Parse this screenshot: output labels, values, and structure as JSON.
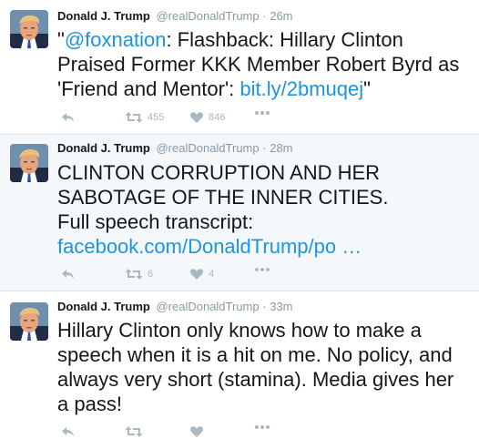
{
  "colors": {
    "link": "#1b95e0",
    "muted": "#8899a6",
    "action": "#aab8c2",
    "highlight_bg": "#f5f8fa"
  },
  "tweets": [
    {
      "name": "Donald J. Trump",
      "handle": "@realDonaldTrump",
      "separator": "·",
      "time": "26m",
      "text_parts": [
        "\"",
        "@foxnation",
        ": Flashback: Hillary Clinton Praised Former KKK Member Robert Byrd as 'Friend and Mentor': ",
        "bit.ly/2bmuqej",
        "\""
      ],
      "retweets": "455",
      "likes": "846"
    },
    {
      "name": "Donald J. Trump",
      "handle": "@realDonaldTrump",
      "separator": "·",
      "time": "28m",
      "text_parts": [
        "CLINTON CORRUPTION AND HER SABOTAGE OF THE INNER CITIES.",
        "Full speech transcript:",
        "facebook.com/DonaldTrump/po …"
      ],
      "retweets": "6",
      "likes": "4"
    },
    {
      "name": "Donald J. Trump",
      "handle": "@realDonaldTrump",
      "separator": "·",
      "time": "33m",
      "text_parts": [
        "Hillary Clinton only knows how to make a speech when it is a hit on me. No policy, and always very short (stamina). Media gives her a pass!"
      ],
      "retweets": "",
      "likes": ""
    }
  ]
}
